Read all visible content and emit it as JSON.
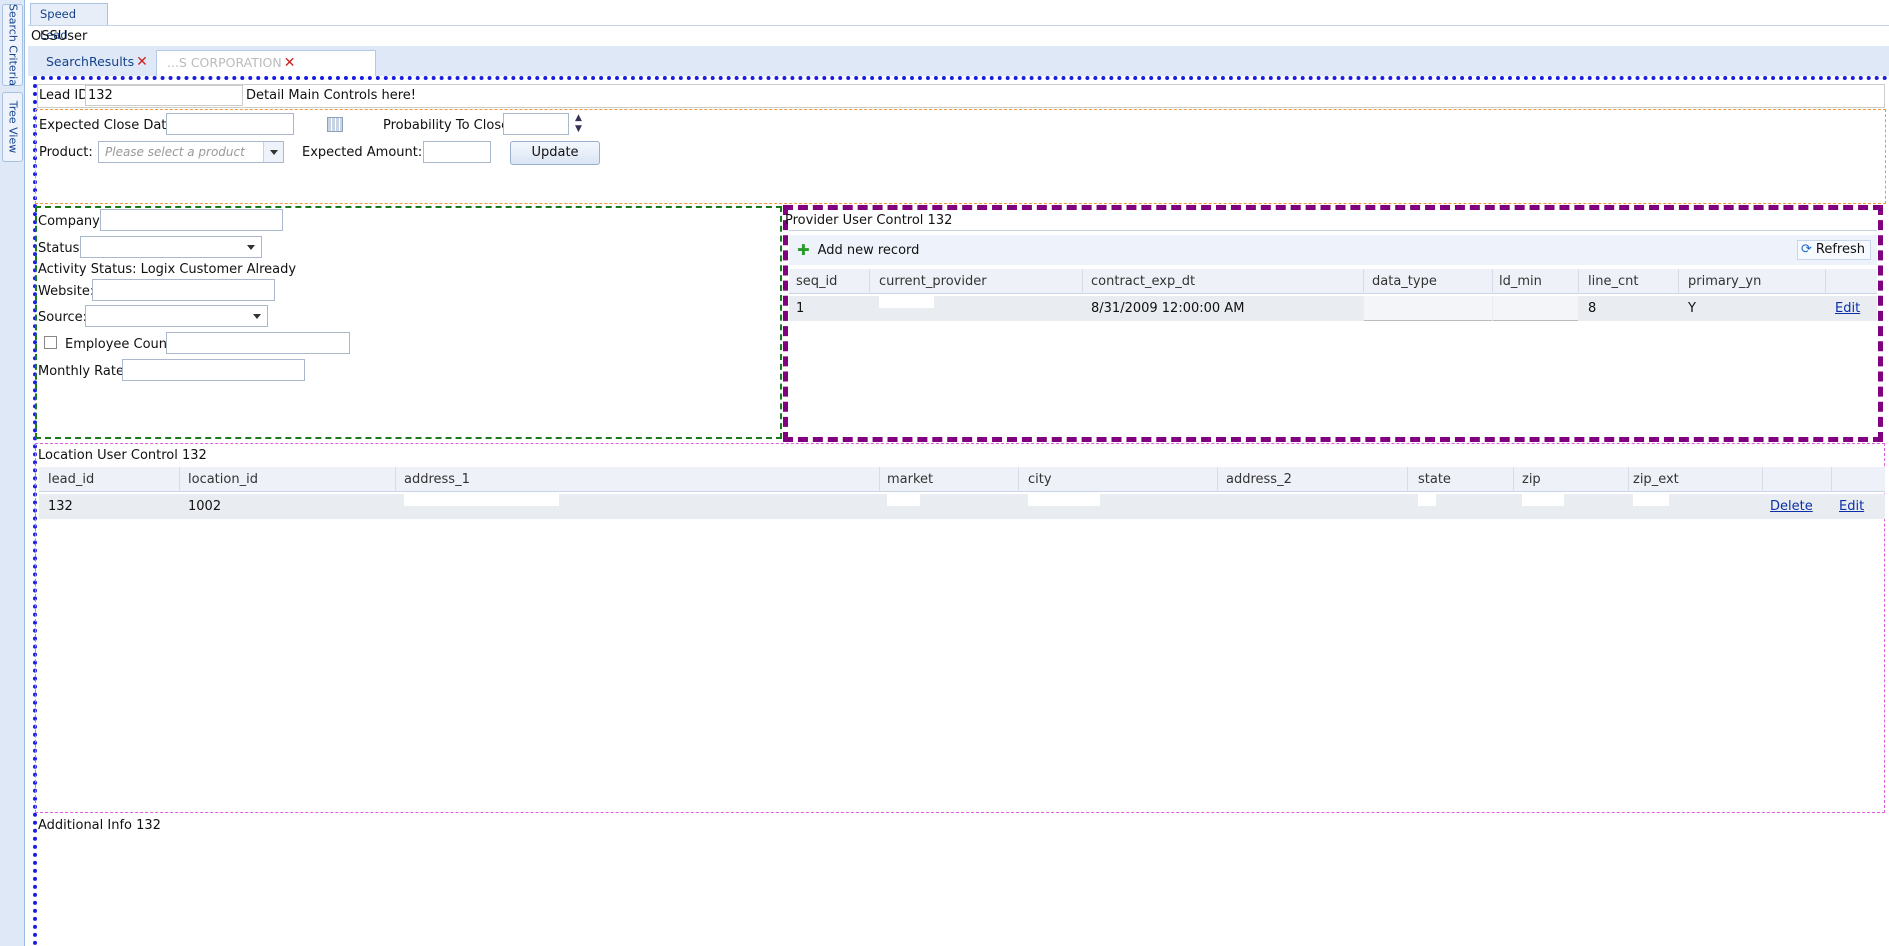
{
  "sidebar": {
    "tabs": [
      {
        "label": "Search Criteria"
      },
      {
        "label": "Tree View"
      }
    ]
  },
  "app": {
    "tab_label": "Speed Lead",
    "user": "OSSUser"
  },
  "doc_tabs": [
    {
      "label": "SearchResults"
    },
    {
      "label": "...S CORPORATION"
    }
  ],
  "lead": {
    "id_label": "Lead ID:",
    "id_value": "132",
    "main_controls_text": "Detail Main Controls here!"
  },
  "controls": {
    "expected_close_date_label": "Expected Close Date:",
    "probability_label": "Probability To Close:",
    "product_label": "Product:",
    "product_placeholder": "Please select a product",
    "expected_amount_label": "Expected Amount:",
    "update_button": "Update"
  },
  "company_form": {
    "company_label": "Company:",
    "status_label": "Status:",
    "activity_status": "Activity Status: Logix Customer Already",
    "website_label": "Website:",
    "source_label": "Source:",
    "employee_count_label": "Employee Count:",
    "monthly_rate_label": "Monthly Rate:"
  },
  "provider": {
    "title": "Provider User Control 132",
    "add_button": "Add new record",
    "refresh_button": "Refresh",
    "columns": [
      "seq_id",
      "current_provider",
      "contract_exp_dt",
      "data_type",
      "ld_min",
      "line_cnt",
      "primary_yn"
    ],
    "rows": [
      {
        "seq_id": "1",
        "current_provider": "",
        "contract_exp_dt": "8/31/2009 12:00:00 AM",
        "data_type": "",
        "ld_min": "",
        "line_cnt": "8",
        "primary_yn": "Y",
        "edit": "Edit"
      }
    ]
  },
  "location": {
    "title": "Location User Control 132",
    "columns": [
      "lead_id",
      "location_id",
      "address_1",
      "market",
      "city",
      "address_2",
      "state",
      "zip",
      "zip_ext"
    ],
    "rows": [
      {
        "lead_id": "132",
        "location_id": "1002",
        "delete": "Delete",
        "edit": "Edit"
      }
    ]
  },
  "additional": {
    "title": "Additional Info 132"
  },
  "colors": {
    "accent": "#15428b",
    "frame_blue": "#1a1ee0",
    "frame_purple": "#800080",
    "frame_green": "#1a7a1a",
    "frame_orange": "#f09a3c",
    "frame_pink": "#e060e0"
  }
}
